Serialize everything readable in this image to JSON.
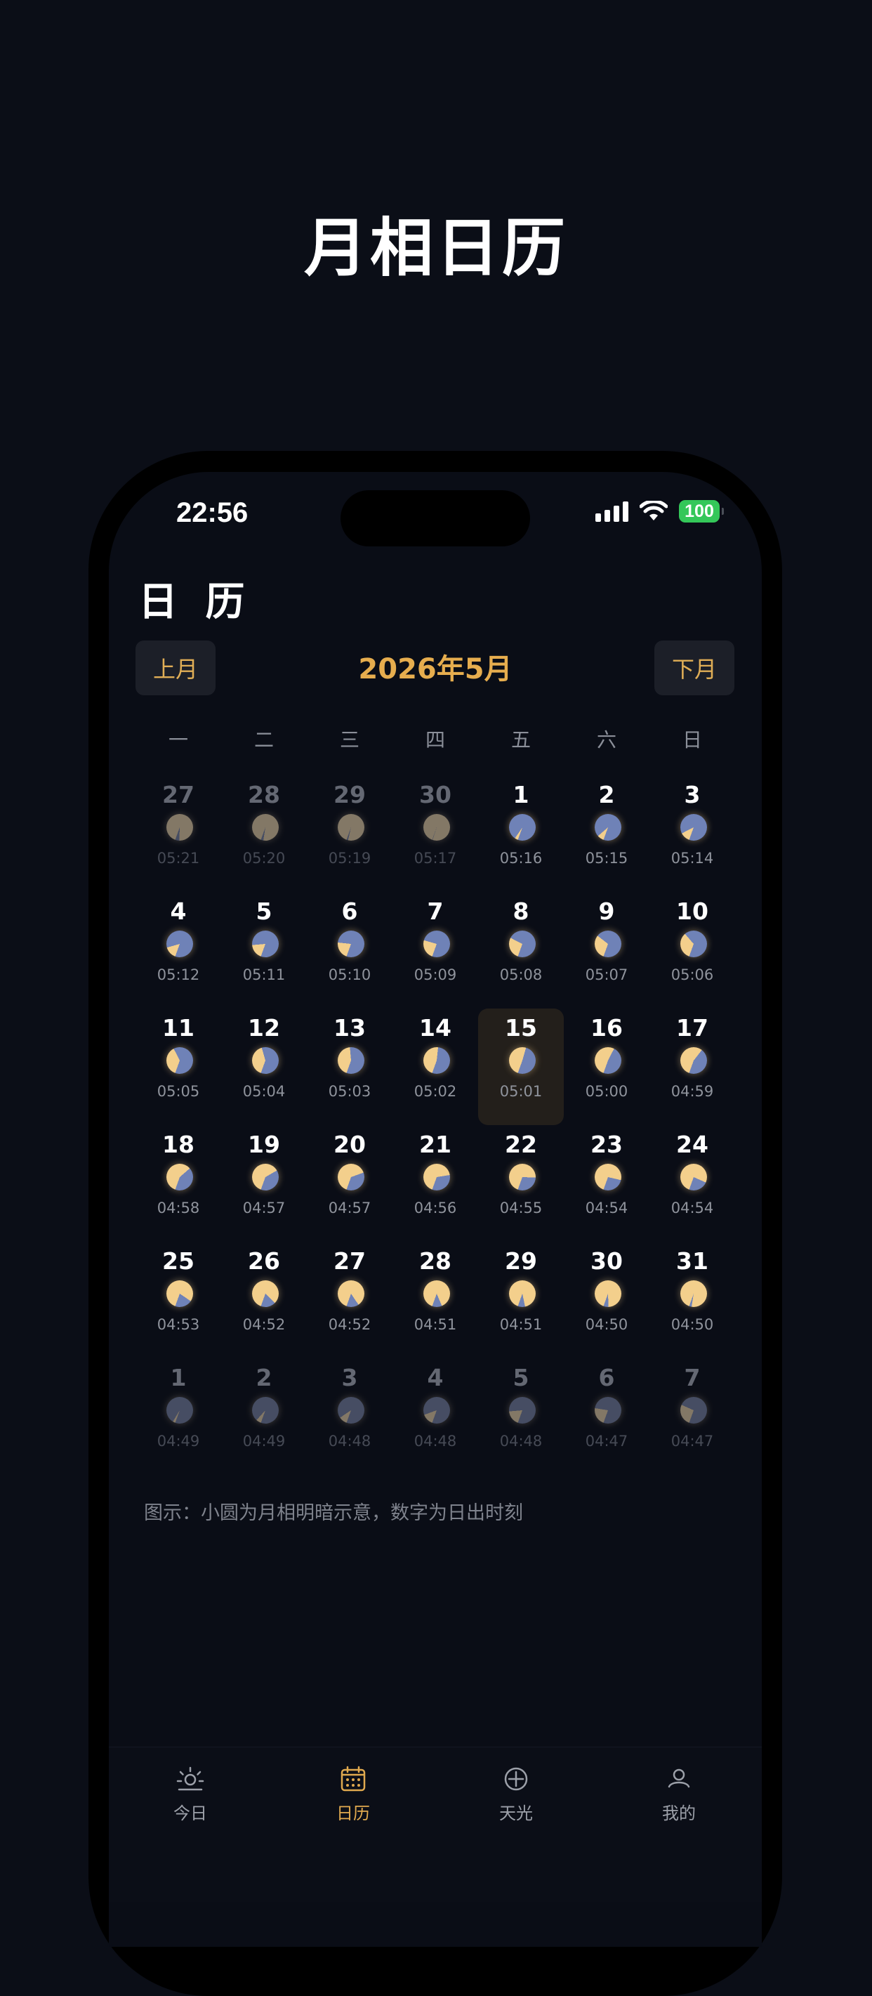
{
  "page": {
    "title": "月相日历"
  },
  "status_bar": {
    "time": "22:56",
    "battery": "100"
  },
  "header": {
    "title": "日 历"
  },
  "calendar": {
    "prev_label": "上月",
    "next_label": "下月",
    "month_title": "2026年5月",
    "weekdays": [
      "一",
      "二",
      "三",
      "四",
      "五",
      "六",
      "日"
    ],
    "today_day": "15",
    "weeks": [
      [
        {
          "day": "27",
          "rise": "05:21",
          "phase": 0.95,
          "other": true
        },
        {
          "day": "28",
          "rise": "05:20",
          "phase": 0.97,
          "other": true
        },
        {
          "day": "29",
          "rise": "05:19",
          "phase": 0.98,
          "other": true
        },
        {
          "day": "30",
          "rise": "05:17",
          "phase": 0.995,
          "other": true
        },
        {
          "day": "1",
          "rise": "05:16",
          "phase": 0.04,
          "other": false
        },
        {
          "day": "2",
          "rise": "05:15",
          "phase": 0.08,
          "other": false
        },
        {
          "day": "3",
          "rise": "05:14",
          "phase": 0.12,
          "other": false
        }
      ],
      [
        {
          "day": "4",
          "rise": "05:12",
          "phase": 0.15,
          "other": false
        },
        {
          "day": "5",
          "rise": "05:11",
          "phase": 0.18,
          "other": false
        },
        {
          "day": "6",
          "rise": "05:10",
          "phase": 0.21,
          "other": false
        },
        {
          "day": "7",
          "rise": "05:09",
          "phase": 0.24,
          "other": false
        },
        {
          "day": "8",
          "rise": "05:08",
          "phase": 0.27,
          "other": false
        },
        {
          "day": "9",
          "rise": "05:07",
          "phase": 0.3,
          "other": false
        },
        {
          "day": "10",
          "rise": "05:06",
          "phase": 0.33,
          "other": false
        }
      ],
      [
        {
          "day": "11",
          "rise": "05:05",
          "phase": 0.37,
          "other": false
        },
        {
          "day": "12",
          "rise": "05:04",
          "phase": 0.4,
          "other": false
        },
        {
          "day": "13",
          "rise": "05:03",
          "phase": 0.43,
          "other": false
        },
        {
          "day": "14",
          "rise": "05:02",
          "phase": 0.46,
          "other": false
        },
        {
          "day": "15",
          "rise": "05:01",
          "phase": 0.49,
          "other": false
        },
        {
          "day": "16",
          "rise": "05:00",
          "phase": 0.52,
          "other": false
        },
        {
          "day": "17",
          "rise": "04:59",
          "phase": 0.55,
          "other": false
        }
      ],
      [
        {
          "day": "18",
          "rise": "04:58",
          "phase": 0.58,
          "other": false
        },
        {
          "day": "19",
          "rise": "04:57",
          "phase": 0.61,
          "other": false
        },
        {
          "day": "20",
          "rise": "04:57",
          "phase": 0.64,
          "other": false
        },
        {
          "day": "21",
          "rise": "04:56",
          "phase": 0.67,
          "other": false
        },
        {
          "day": "22",
          "rise": "04:55",
          "phase": 0.7,
          "other": false
        },
        {
          "day": "23",
          "rise": "04:54",
          "phase": 0.73,
          "other": false
        },
        {
          "day": "24",
          "rise": "04:54",
          "phase": 0.76,
          "other": false
        }
      ],
      [
        {
          "day": "25",
          "rise": "04:53",
          "phase": 0.79,
          "other": false
        },
        {
          "day": "26",
          "rise": "04:52",
          "phase": 0.82,
          "other": false
        },
        {
          "day": "27",
          "rise": "04:52",
          "phase": 0.85,
          "other": false
        },
        {
          "day": "28",
          "rise": "04:51",
          "phase": 0.88,
          "other": false
        },
        {
          "day": "29",
          "rise": "04:51",
          "phase": 0.91,
          "other": false
        },
        {
          "day": "30",
          "rise": "04:50",
          "phase": 0.94,
          "other": false
        },
        {
          "day": "31",
          "rise": "04:50",
          "phase": 0.97,
          "other": false
        }
      ],
      [
        {
          "day": "1",
          "rise": "04:49",
          "phase": 0.03,
          "other": true
        },
        {
          "day": "2",
          "rise": "04:49",
          "phase": 0.06,
          "other": true
        },
        {
          "day": "3",
          "rise": "04:48",
          "phase": 0.1,
          "other": true
        },
        {
          "day": "4",
          "rise": "04:48",
          "phase": 0.14,
          "other": true
        },
        {
          "day": "5",
          "rise": "04:48",
          "phase": 0.18,
          "other": true
        },
        {
          "day": "6",
          "rise": "04:47",
          "phase": 0.22,
          "other": true
        },
        {
          "day": "7",
          "rise": "04:47",
          "phase": 0.26,
          "other": true
        }
      ]
    ]
  },
  "legend": "图示：小圆为月相明暗示意，数字为日出时刻",
  "tabs": [
    {
      "label": "今日",
      "icon": "sunrise-icon",
      "active": false
    },
    {
      "label": "日历",
      "icon": "calendar-icon",
      "active": true
    },
    {
      "label": "天光",
      "icon": "compass-icon",
      "active": false
    },
    {
      "label": "我的",
      "icon": "user-icon",
      "active": false
    }
  ],
  "colors": {
    "accent": "#e6ad4e",
    "moon_dark": "#6f82b7",
    "moon_light": "#f3cf8c",
    "background": "#0b0e17"
  }
}
